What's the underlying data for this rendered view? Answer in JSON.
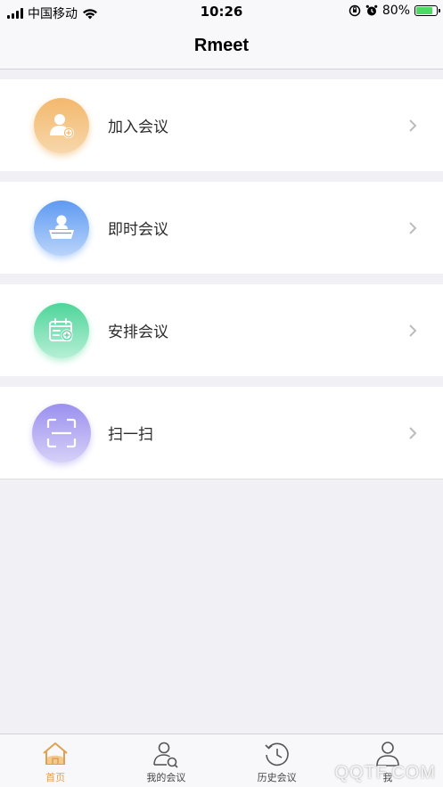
{
  "status_bar": {
    "carrier": "中国移动",
    "time": "10:26",
    "battery": "80%",
    "battery_level": 0.8
  },
  "nav": {
    "title": "Rmeet"
  },
  "menu": [
    {
      "label": "加入会议",
      "icon": "join-meeting-icon",
      "color_top": "#f3b86c",
      "color_bottom": "#f7d7ac"
    },
    {
      "label": "即时会议",
      "icon": "instant-meeting-icon",
      "color_top": "#5f9af2",
      "color_bottom": "#b9d4fa"
    },
    {
      "label": "安排会议",
      "icon": "schedule-meeting-icon",
      "color_top": "#4ed59a",
      "color_bottom": "#b6efd5"
    },
    {
      "label": "扫一扫",
      "icon": "scan-icon",
      "color_top": "#9b90ef",
      "color_bottom": "#d6d1f8"
    }
  ],
  "tabs": [
    {
      "label": "首页",
      "icon": "home-icon",
      "active": true
    },
    {
      "label": "我的会议",
      "icon": "my-meetings-icon",
      "active": false
    },
    {
      "label": "历史会议",
      "icon": "history-icon",
      "active": false
    },
    {
      "label": "我",
      "icon": "profile-icon",
      "active": false
    }
  ],
  "watermark": "QQTF.COM",
  "colors": {
    "accent": "#e0a050",
    "background": "#f1f0f5"
  }
}
